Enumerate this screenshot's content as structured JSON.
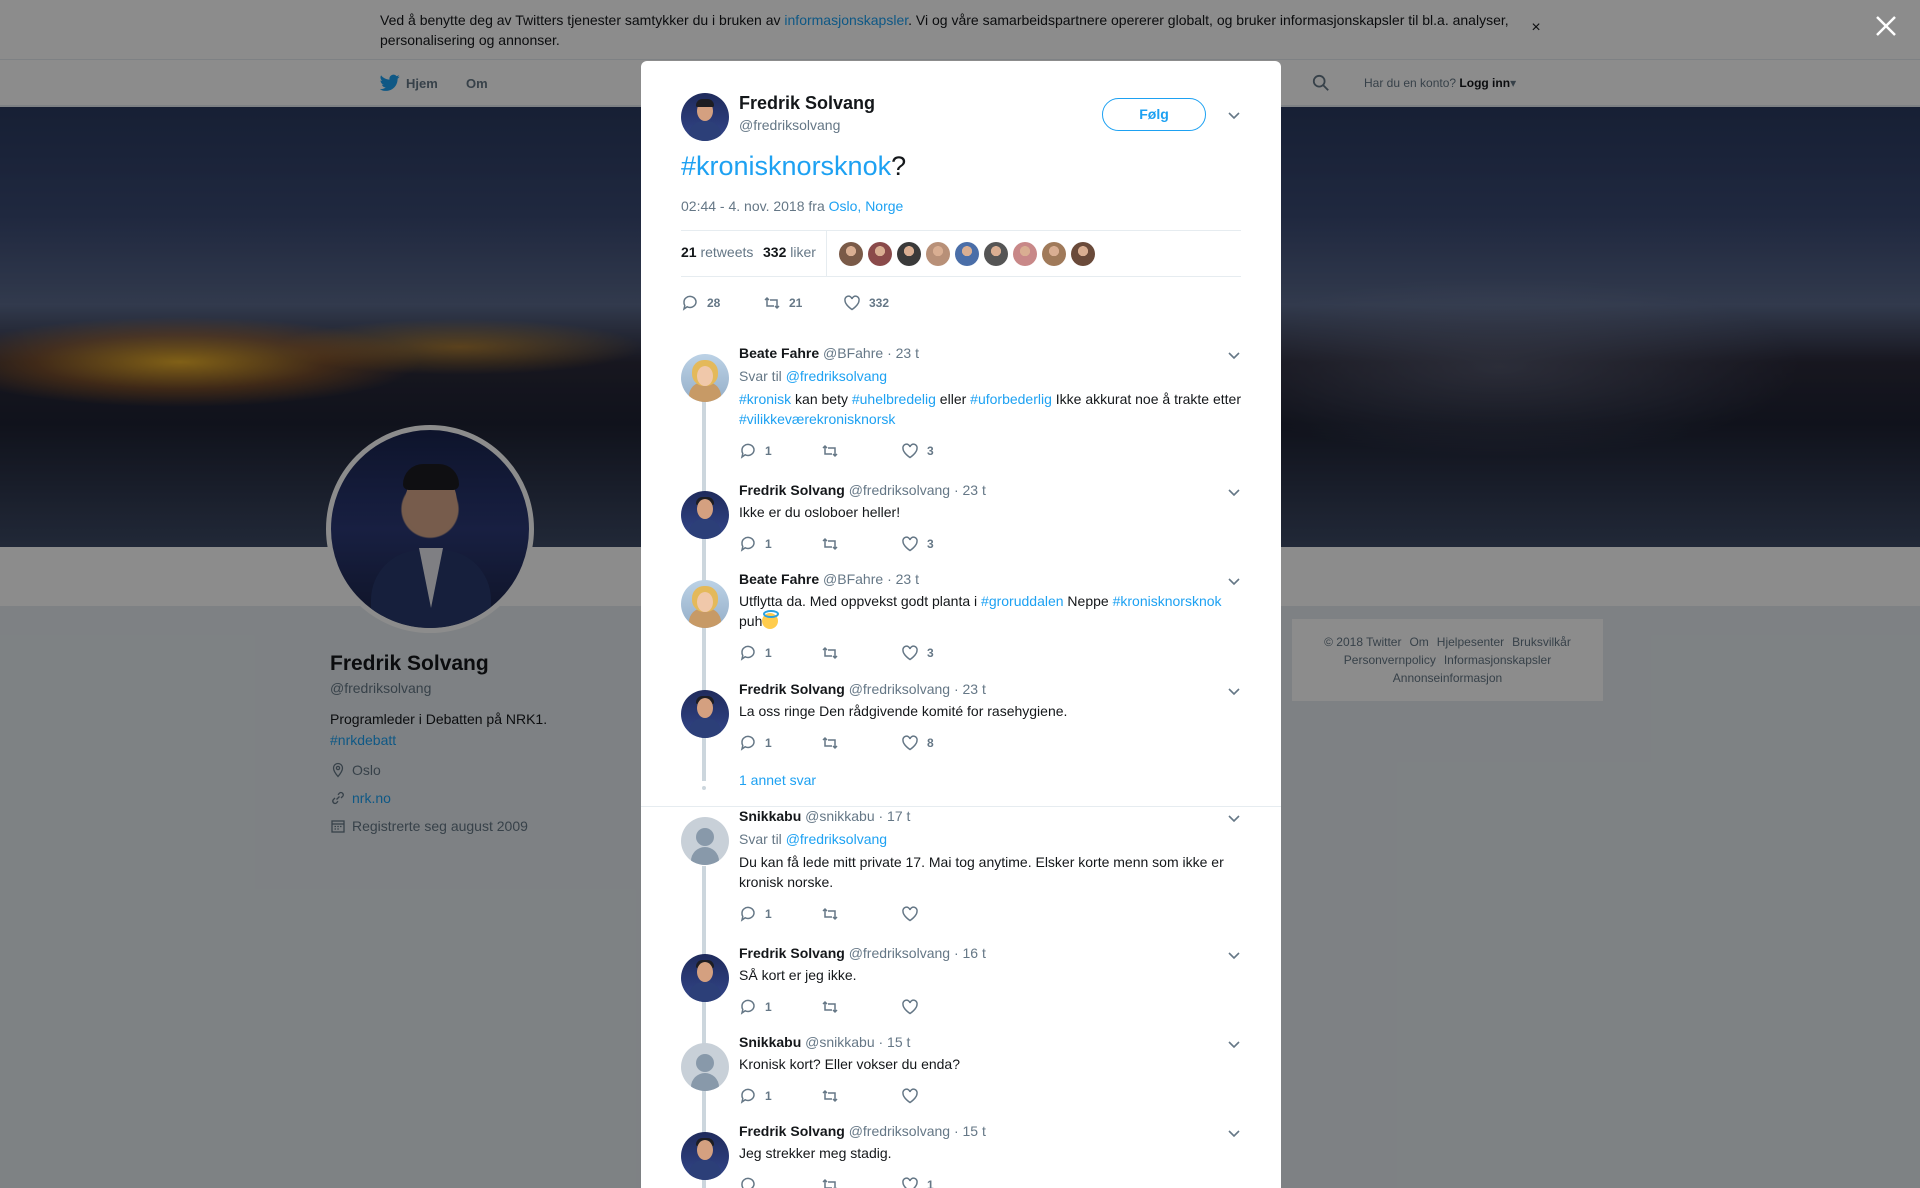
{
  "cookie": {
    "text_before": "Ved å benytte deg av Twitters tjenester samtykker du i bruken av ",
    "link": "informasjonskapsler",
    "text_after": ". Vi og våre samarbeidspartnere opererer globalt, og bruker informasjonskapsler til bl.a. analyser, personalisering og annonser.",
    "close": "×"
  },
  "nav": {
    "home": "Hjem",
    "about": "Om",
    "login_prompt": "Har du en konto?",
    "login": "Logg inn"
  },
  "profile": {
    "name": "Fredrik Solvang",
    "handle": "@fredriksolvang",
    "bio": "Programleder i Debatten på NRK1.",
    "bio_tag": "#nrkdebatt",
    "location": "Oslo",
    "website": "nrk.no",
    "joined": "Registrerte seg august 2009"
  },
  "footer": {
    "copyright": "© 2018 Twitter",
    "about": "Om",
    "help": "Hjelpesenter",
    "terms": "Bruksvilkår",
    "privacy": "Personvernpolicy",
    "cookies": "Informasjonskapsler",
    "ads": "Annonseinformasjon"
  },
  "tweet": {
    "name": "Fredrik Solvang",
    "handle": "@fredriksolvang",
    "follow": "Følg",
    "hashtag": "#kronisknorsknok",
    "text_after": "?",
    "timestamp": "02:44 - 4. nov. 2018 fra ",
    "location": "Oslo, Norge",
    "retweets_count": "21",
    "retweets_label": "retweets",
    "likes_count": "332",
    "likes_label": "liker",
    "liker_colors": [
      "#7a5a48",
      "#8a4a4a",
      "#3a3a3a",
      "#b89078",
      "#4a6ea8",
      "#555555",
      "#c88888",
      "#a07a5a",
      "#6a4a3a"
    ],
    "actions": {
      "replies": "28",
      "retweets": "21",
      "likes": "332"
    }
  },
  "replies": [
    {
      "name": "Beate Fahre",
      "handle": "@BFahre",
      "time": "· 23 t",
      "reply_to_label": "Svar til ",
      "reply_to": "@fredriksolvang",
      "segments": [
        [
          "#kronisk",
          true
        ],
        [
          " kan bety ",
          false
        ],
        [
          "#uhelbredelig",
          true
        ],
        [
          " eller ",
          false
        ],
        [
          "#uforbederlig",
          true
        ],
        [
          " Ikke akkurat noe å trakte etter ",
          false
        ],
        [
          "#vilikkeværekronisknorsk",
          true
        ]
      ],
      "actions": {
        "replies": "1",
        "retweets": "",
        "likes": "3"
      }
    },
    {
      "name": "Fredrik Solvang",
      "handle": "@fredriksolvang",
      "time": "· 23 t",
      "text": "Ikke er du osloboer heller!",
      "actions": {
        "replies": "1",
        "retweets": "",
        "likes": "3"
      }
    },
    {
      "name": "Beate Fahre",
      "handle": "@BFahre",
      "time": "· 23 t",
      "segments": [
        [
          "Utflytta da. Med oppvekst godt planta i ",
          false
        ],
        [
          "#groruddalen",
          true
        ],
        [
          " Neppe ",
          false
        ],
        [
          "#kronisknorsknok",
          true
        ],
        [
          " puh",
          false
        ]
      ],
      "actions": {
        "replies": "1",
        "retweets": "",
        "likes": "3"
      }
    },
    {
      "name": "Fredrik Solvang",
      "handle": "@fredriksolvang",
      "time": "· 23 t",
      "text": "La oss ringe Den rådgivende komité for rasehygiene.",
      "actions": {
        "replies": "1",
        "retweets": "",
        "likes": "8"
      }
    },
    {
      "name": "Snikkabu",
      "handle": "@snikkabu",
      "time": "· 17 t",
      "reply_to_label": "Svar til ",
      "reply_to": "@fredriksolvang",
      "text": "Du kan få lede mitt private 17. Mai tog anytime. Elsker korte menn som ikke er kronisk norske.",
      "actions": {
        "replies": "1",
        "retweets": "",
        "likes": ""
      }
    },
    {
      "name": "Fredrik Solvang",
      "handle": "@fredriksolvang",
      "time": "· 16 t",
      "text": "SÅ kort er jeg ikke.",
      "actions": {
        "replies": "1",
        "retweets": "",
        "likes": ""
      }
    },
    {
      "name": "Snikkabu",
      "handle": "@snikkabu",
      "time": "· 15 t",
      "text": "Kronisk kort? Eller vokser du enda?",
      "actions": {
        "replies": "1",
        "retweets": "",
        "likes": ""
      }
    },
    {
      "name": "Fredrik Solvang",
      "handle": "@fredriksolvang",
      "time": "· 15 t",
      "text": "Jeg strekker meg stadig.",
      "actions": {
        "replies": "",
        "retweets": "",
        "likes": "1"
      }
    }
  ],
  "more_replies": "1 annet svar",
  "colors": {
    "accent": "#1da1f2",
    "text": "#14171a",
    "muted": "#657786"
  }
}
